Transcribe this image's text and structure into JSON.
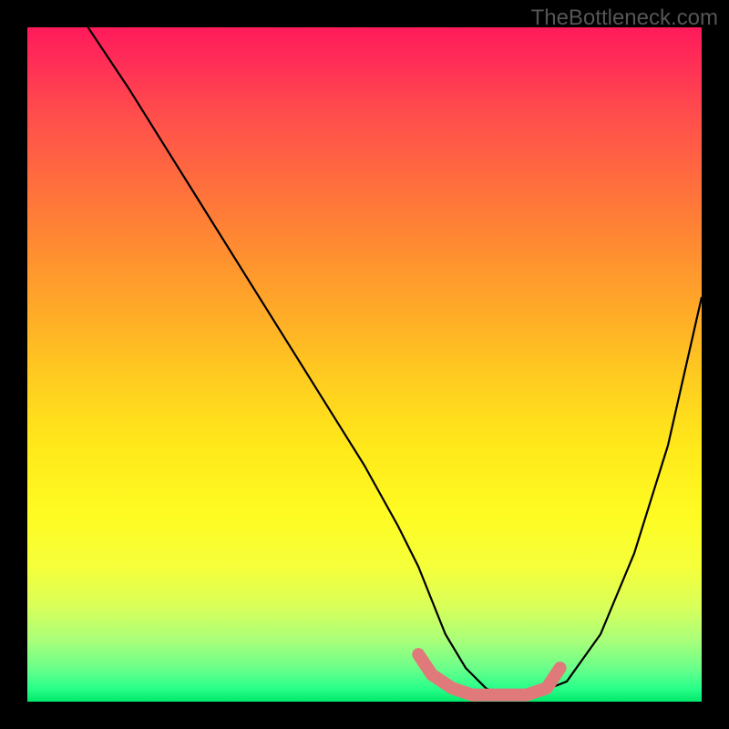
{
  "watermark": "TheBottleneck.com",
  "chart_data": {
    "type": "line",
    "title": "",
    "xlabel": "",
    "ylabel": "",
    "xlim": [
      0,
      100
    ],
    "ylim": [
      0,
      100
    ],
    "grid": false,
    "series": [
      {
        "name": "curve",
        "color": "#000000",
        "x": [
          9,
          15,
          20,
          25,
          30,
          35,
          40,
          45,
          50,
          55,
          58,
          60,
          62,
          65,
          68,
          70,
          72,
          75,
          80,
          85,
          90,
          95,
          100
        ],
        "y": [
          100,
          91,
          83,
          75,
          67,
          59,
          51,
          43,
          35,
          26,
          20,
          15,
          10,
          5,
          2,
          1,
          1,
          1,
          3,
          10,
          22,
          38,
          60
        ]
      }
    ],
    "highlight": {
      "name": "bottom-marker",
      "color": "#e07a7a",
      "x": [
        58,
        60,
        63,
        66,
        70,
        74,
        77,
        79
      ],
      "y": [
        7,
        4,
        2,
        1,
        1,
        1,
        2,
        5
      ]
    },
    "gradient_stops": [
      {
        "pct": 0,
        "color": "#ff1a5a"
      },
      {
        "pct": 50,
        "color": "#ffcc20"
      },
      {
        "pct": 80,
        "color": "#f5ff3a"
      },
      {
        "pct": 100,
        "color": "#00e86a"
      }
    ]
  }
}
